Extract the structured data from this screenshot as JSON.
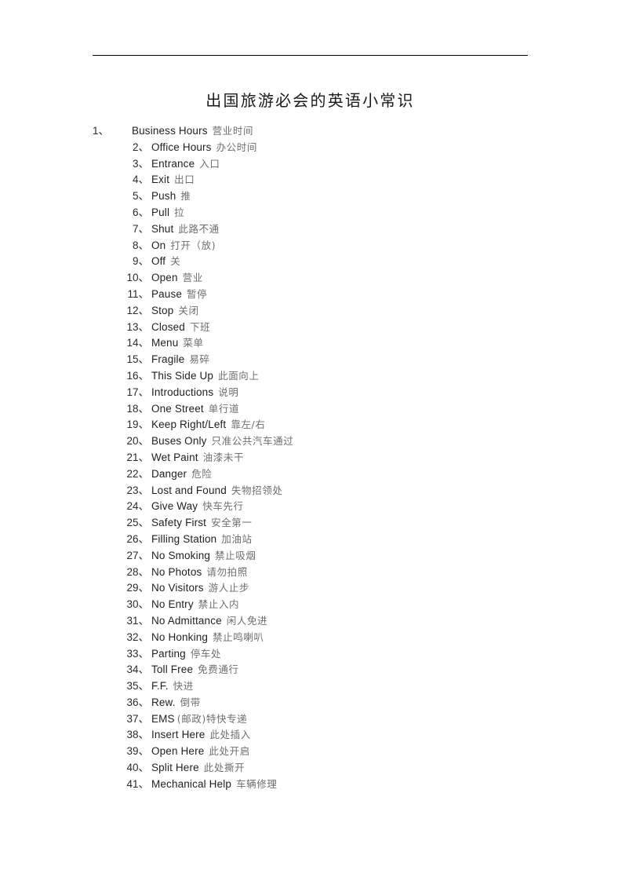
{
  "document": {
    "title": "出国旅游必会的英语小常识",
    "header_rule_visible": true,
    "background_color": "#ffffff",
    "english_text_color": "#1f1f1f",
    "chinese_text_color": "#6e6e6e"
  },
  "list": {
    "separator": "、",
    "items": [
      {
        "num": "1",
        "en": "Business Hours",
        "zh": "营业时间"
      },
      {
        "num": "2",
        "en": "Office Hours",
        "zh": "办公时间"
      },
      {
        "num": "3",
        "en": "Entrance",
        "zh": "入口"
      },
      {
        "num": "4",
        "en": "Exit",
        "zh": "出口"
      },
      {
        "num": "5",
        "en": "Push",
        "zh": "推"
      },
      {
        "num": "6",
        "en": "Pull",
        "zh": "拉"
      },
      {
        "num": "7",
        "en": "Shut",
        "zh": "此路不通"
      },
      {
        "num": "8",
        "en": "On",
        "zh": "打开（放)"
      },
      {
        "num": "9",
        "en": "Off",
        "zh": "关"
      },
      {
        "num": "10",
        "en": "Open",
        "zh": "营业"
      },
      {
        "num": "11",
        "en": "Pause",
        "zh": "暂停"
      },
      {
        "num": "12",
        "en": "Stop",
        "zh": "关闭"
      },
      {
        "num": "13",
        "en": "Closed",
        "zh": "下班"
      },
      {
        "num": "14",
        "en": "Menu",
        "zh": "菜单"
      },
      {
        "num": "15",
        "en": "Fragile",
        "zh": "易碎"
      },
      {
        "num": "16",
        "en": "This Side Up",
        "zh": "此面向上"
      },
      {
        "num": "17",
        "en": "Introductions",
        "zh": "说明"
      },
      {
        "num": "18",
        "en": "One Street",
        "zh": "单行道"
      },
      {
        "num": "19",
        "en": "Keep Right/Left",
        "zh": "靠左/右"
      },
      {
        "num": "20",
        "en": "Buses Only",
        "zh": "只准公共汽车通过"
      },
      {
        "num": "21",
        "en": "Wet Paint",
        "zh": "油漆未干"
      },
      {
        "num": "22",
        "en": "Danger",
        "zh": "危险"
      },
      {
        "num": "23",
        "en": "Lost and Found",
        "zh": "失物招领处"
      },
      {
        "num": "24",
        "en": "Give Way",
        "zh": "快车先行"
      },
      {
        "num": "25",
        "en": "Safety First",
        "zh": "安全第一"
      },
      {
        "num": "26",
        "en": "Filling Station",
        "zh": "加油站"
      },
      {
        "num": "27",
        "en": "No Smoking",
        "zh": "禁止吸烟"
      },
      {
        "num": "28",
        "en": "No Photos",
        "zh": "请勿拍照"
      },
      {
        "num": "29",
        "en": "No Visitors",
        "zh": "游人止步"
      },
      {
        "num": "30",
        "en": "No Entry",
        "zh": "禁止入内"
      },
      {
        "num": "31",
        "en": "No Admittance",
        "zh": "闲人免进"
      },
      {
        "num": "32",
        "en": "No Honking",
        "zh": "禁止鸣喇叭"
      },
      {
        "num": "33",
        "en": "Parting",
        "zh": "停车处"
      },
      {
        "num": "34",
        "en": "Toll Free",
        "zh": "免费通行"
      },
      {
        "num": "35",
        "en": "F.F.",
        "zh": "快进"
      },
      {
        "num": "36",
        "en": "Rew.",
        "zh": "倒带"
      },
      {
        "num": "37",
        "en": "EMS",
        "zh": "(邮政)特快专递",
        "tight": true
      },
      {
        "num": "38",
        "en": "Insert Here",
        "zh": "此处插入"
      },
      {
        "num": "39",
        "en": "Open Here",
        "zh": "此处开启"
      },
      {
        "num": "40",
        "en": "Split Here",
        "zh": "此处撕开"
      },
      {
        "num": "41",
        "en": "Mechanical Help",
        "zh": "车辆修理"
      }
    ]
  }
}
